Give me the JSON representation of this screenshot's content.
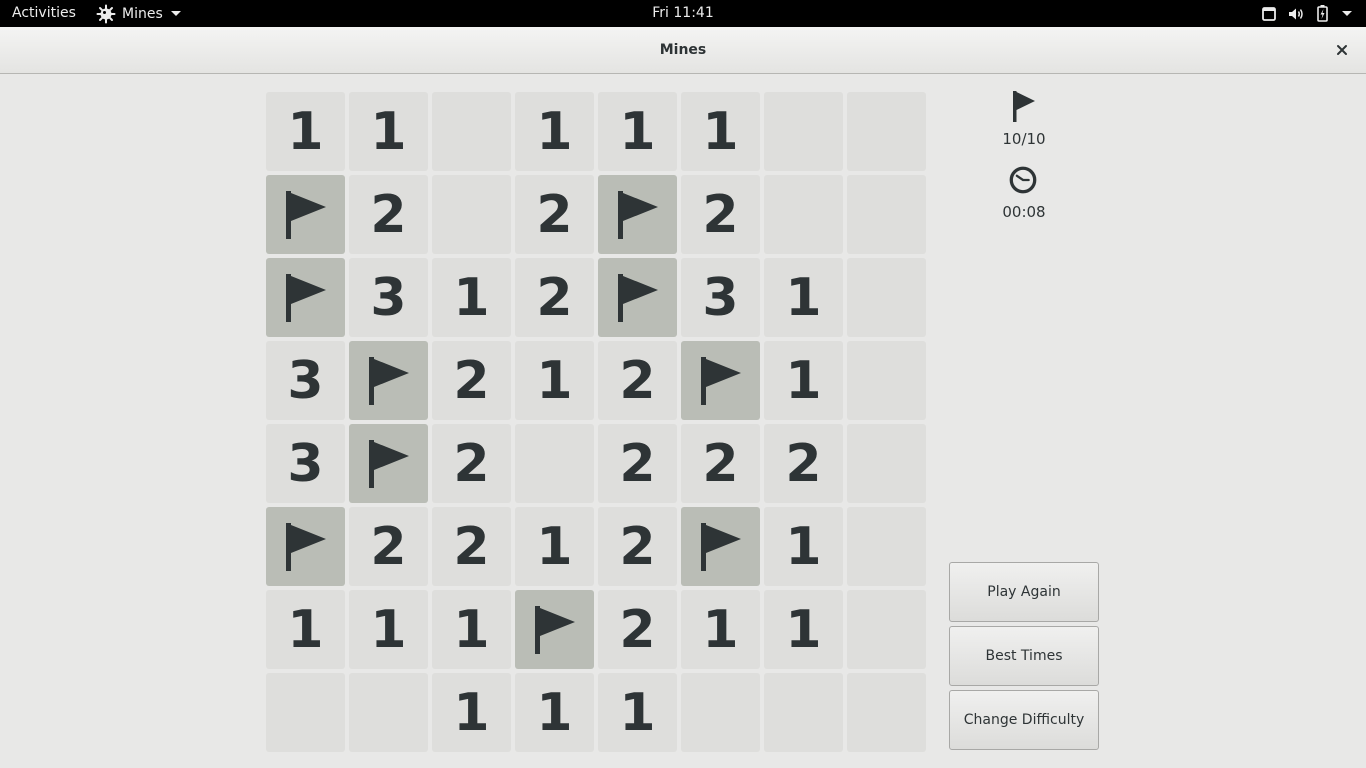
{
  "topbar": {
    "activities": "Activities",
    "app_name": "Mines",
    "clock": "Fri 11:41"
  },
  "window": {
    "title": "Mines"
  },
  "board": {
    "rows": [
      [
        "1",
        "1",
        "",
        "1",
        "1",
        "1",
        "",
        ""
      ],
      [
        "F",
        "2",
        "",
        "2",
        "F",
        "2",
        "",
        ""
      ],
      [
        "F",
        "3",
        "1",
        "2",
        "F",
        "3",
        "1",
        ""
      ],
      [
        "3",
        "F",
        "2",
        "1",
        "2",
        "F",
        "1",
        ""
      ],
      [
        "3",
        "F",
        "2",
        "",
        "2",
        "2",
        "2",
        ""
      ],
      [
        "F",
        "2",
        "2",
        "1",
        "2",
        "F",
        "1",
        ""
      ],
      [
        "1",
        "1",
        "1",
        "F",
        "2",
        "1",
        "1",
        ""
      ],
      [
        "",
        "",
        "1",
        "1",
        "1",
        "",
        "",
        ""
      ]
    ]
  },
  "status": {
    "flags": "10/10",
    "time": "00:08"
  },
  "buttons": {
    "play_again": "Play Again",
    "best_times": "Best Times",
    "change_difficulty": "Change Difficulty"
  },
  "colors": {
    "cell_revealed": "#dededc",
    "cell_flagged": "#babdb6",
    "digit": "#2e3436"
  },
  "icons": {
    "app": "mines-app-icon",
    "flag": "flag-icon",
    "clock": "clock-icon",
    "close": "close-icon"
  }
}
